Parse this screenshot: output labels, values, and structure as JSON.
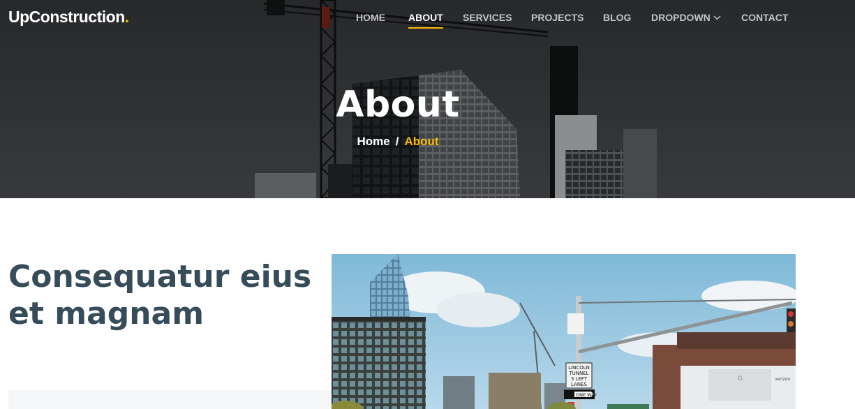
{
  "brand": {
    "name": "UpConstruction",
    "dot": "."
  },
  "nav": {
    "items": [
      {
        "label": "Home"
      },
      {
        "label": "About"
      },
      {
        "label": "Services"
      },
      {
        "label": "Projects"
      },
      {
        "label": "Blog"
      },
      {
        "label": "Dropdown"
      },
      {
        "label": "Contact"
      }
    ],
    "active": "About"
  },
  "hero": {
    "title": "About"
  },
  "breadcrumb": {
    "home": "Home",
    "separator": "/",
    "current": "About"
  },
  "section": {
    "heading": "Consequatur eius et magnam"
  },
  "photo": {
    "signs": {
      "tunnel_line1": "LINCOLN",
      "tunnel_line2": "TUNNEL",
      "tunnel_line3": "3 LEFT",
      "tunnel_line4": "LANES",
      "one_way": "ONE WAY",
      "billboard_brand": "verizon",
      "billboard_letter": "G"
    }
  },
  "colors": {
    "accent": "#feb900",
    "heading": "#364d59",
    "hero_bg": "#34373a"
  },
  "icons": {
    "dropdown": "chevron-down-icon"
  }
}
